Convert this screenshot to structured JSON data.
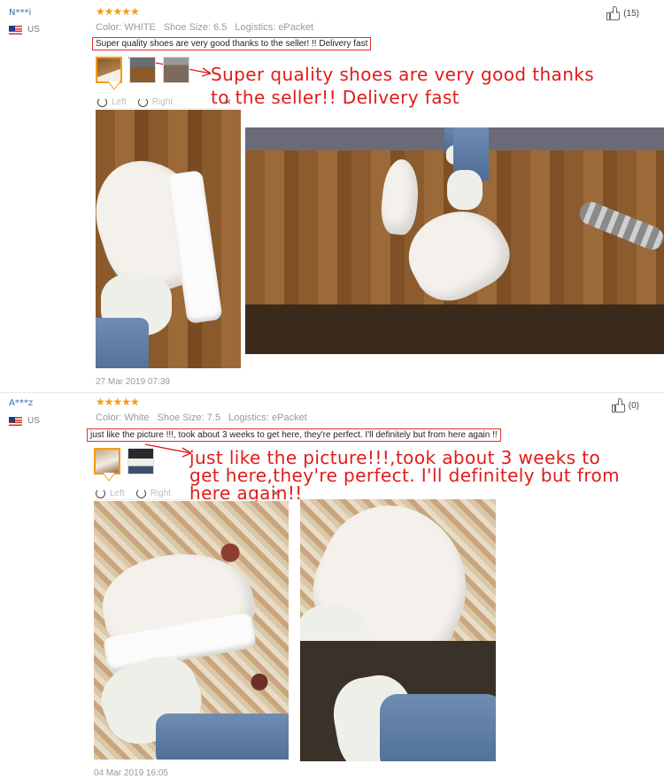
{
  "reviews": [
    {
      "user": "N***i",
      "country": "US",
      "stars": "★★★★★",
      "color": "Color: WHITE",
      "size": "Shoe Size: 6.5",
      "logistics": "Logistics: ePacket",
      "helpful_count": "(15)",
      "text": "Super quality shoes are very good thanks to the seller! !! Delivery fast",
      "handwritten_note": [
        "Super quality shoes are very good thanks",
        "to the seller!! Delivery fast"
      ],
      "rotate_left": "Left",
      "rotate_right": "Right",
      "close": "×",
      "date": "27 Mar 2019 07:39"
    },
    {
      "user": "A***z",
      "country": "US",
      "stars": "★★★★★",
      "color": "Color: White",
      "size": "Shoe Size: 7.5",
      "logistics": "Logistics: ePacket",
      "helpful_count": "(0)",
      "text": "just like the picture !!!, took about 3 weeks to get here, they're perfect. I'll definitely but from here again !!",
      "handwritten_note": [
        "just like the picture!!!,took about 3 weeks to",
        "get here,they're perfect. I'll definitely but from",
        "here again!!"
      ],
      "rotate_left": "Left",
      "rotate_right": "Right",
      "close": "×",
      "date": "04 Mar 2019 16:05"
    }
  ],
  "colors": {
    "accent_red": "#e01b1b",
    "star_orange": "#f39c12",
    "username_blue": "#3a6bb0"
  }
}
